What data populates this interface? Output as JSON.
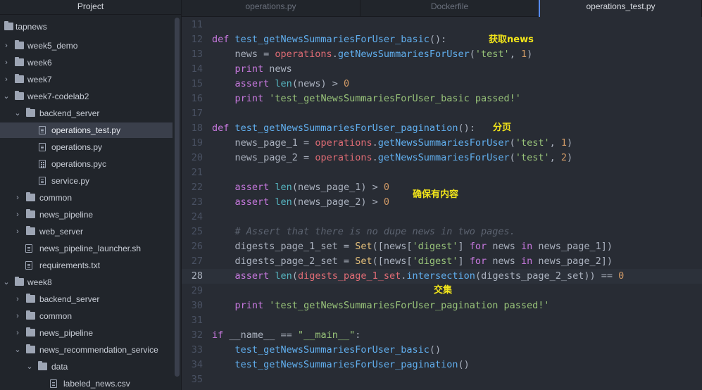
{
  "sidebar": {
    "title": "Project",
    "items": [
      {
        "label": "tapnews",
        "type": "folder",
        "chevron": ""
      },
      {
        "label": "week5_demo",
        "type": "folder",
        "chevron": "›"
      },
      {
        "label": "week6",
        "type": "folder",
        "chevron": "›"
      },
      {
        "label": "week7",
        "type": "folder",
        "chevron": "›"
      },
      {
        "label": "week7-codelab2",
        "type": "folder",
        "chevron": "⌄"
      },
      {
        "label": "backend_server",
        "type": "folder",
        "chevron": "⌄"
      },
      {
        "label": "operations_test.py",
        "type": "file",
        "chevron": ""
      },
      {
        "label": "operations.py",
        "type": "file",
        "chevron": ""
      },
      {
        "label": "operations.pyc",
        "type": "binfile",
        "chevron": ""
      },
      {
        "label": "service.py",
        "type": "file",
        "chevron": ""
      },
      {
        "label": "common",
        "type": "folder",
        "chevron": "›"
      },
      {
        "label": "news_pipeline",
        "type": "folder",
        "chevron": "›"
      },
      {
        "label": "web_server",
        "type": "folder",
        "chevron": "›"
      },
      {
        "label": "news_pipeline_launcher.sh",
        "type": "file",
        "chevron": ""
      },
      {
        "label": "requirements.txt",
        "type": "file",
        "chevron": ""
      },
      {
        "label": "week8",
        "type": "folder",
        "chevron": "⌄"
      },
      {
        "label": "backend_server",
        "type": "folder",
        "chevron": "›"
      },
      {
        "label": "common",
        "type": "folder",
        "chevron": "›"
      },
      {
        "label": "news_pipeline",
        "type": "folder",
        "chevron": "›"
      },
      {
        "label": "news_recommendation_service",
        "type": "folder",
        "chevron": "⌄"
      },
      {
        "label": "data",
        "type": "folder",
        "chevron": "⌄"
      },
      {
        "label": "labeled_news.csv",
        "type": "file",
        "chevron": ""
      }
    ]
  },
  "tabs": [
    {
      "label": "operations.py",
      "active": false
    },
    {
      "label": "Dockerfile",
      "active": false
    },
    {
      "label": "operations_test.py",
      "active": true
    }
  ],
  "editor": {
    "cursor_line": "28",
    "lines": [
      {
        "num": "11",
        "tokens": []
      },
      {
        "num": "12",
        "tokens": [
          [
            "kw",
            "def "
          ],
          [
            "fn",
            "test_getNewsSummariesForUser_basic"
          ],
          [
            "id",
            "():"
          ]
        ]
      },
      {
        "num": "13",
        "tokens": [
          [
            "id",
            "    news = "
          ],
          [
            "mod",
            "operations"
          ],
          [
            "id",
            "."
          ],
          [
            "fn",
            "getNewsSummariesForUser"
          ],
          [
            "id",
            "("
          ],
          [
            "str",
            "'test'"
          ],
          [
            "id",
            ", "
          ],
          [
            "num",
            "1"
          ],
          [
            "id",
            ")"
          ]
        ]
      },
      {
        "num": "14",
        "tokens": [
          [
            "id",
            "    "
          ],
          [
            "kw",
            "print"
          ],
          [
            "id",
            " news"
          ]
        ]
      },
      {
        "num": "15",
        "tokens": [
          [
            "id",
            "    "
          ],
          [
            "kw",
            "assert "
          ],
          [
            "bi",
            "len"
          ],
          [
            "id",
            "(news) > "
          ],
          [
            "num",
            "0"
          ]
        ]
      },
      {
        "num": "16",
        "tokens": [
          [
            "id",
            "    "
          ],
          [
            "kw",
            "print "
          ],
          [
            "str",
            "'test_getNewsSummariesForUser_basic passed!'"
          ]
        ]
      },
      {
        "num": "17",
        "tokens": []
      },
      {
        "num": "18",
        "tokens": [
          [
            "kw",
            "def "
          ],
          [
            "fn",
            "test_getNewsSummariesForUser_pagination"
          ],
          [
            "id",
            "():"
          ]
        ]
      },
      {
        "num": "19",
        "tokens": [
          [
            "id",
            "    news_page_1 = "
          ],
          [
            "mod",
            "operations"
          ],
          [
            "id",
            "."
          ],
          [
            "fn",
            "getNewsSummariesForUser"
          ],
          [
            "id",
            "("
          ],
          [
            "str",
            "'test'"
          ],
          [
            "id",
            ", "
          ],
          [
            "num",
            "1"
          ],
          [
            "id",
            ")"
          ]
        ]
      },
      {
        "num": "20",
        "tokens": [
          [
            "id",
            "    news_page_2 = "
          ],
          [
            "mod",
            "operations"
          ],
          [
            "id",
            "."
          ],
          [
            "fn",
            "getNewsSummariesForUser"
          ],
          [
            "id",
            "("
          ],
          [
            "str",
            "'test'"
          ],
          [
            "id",
            ", "
          ],
          [
            "num",
            "2"
          ],
          [
            "id",
            ")"
          ]
        ]
      },
      {
        "num": "21",
        "tokens": []
      },
      {
        "num": "22",
        "tokens": [
          [
            "id",
            "    "
          ],
          [
            "kw",
            "assert "
          ],
          [
            "bi",
            "len"
          ],
          [
            "id",
            "(news_page_1) > "
          ],
          [
            "num",
            "0"
          ]
        ]
      },
      {
        "num": "23",
        "tokens": [
          [
            "id",
            "    "
          ],
          [
            "kw",
            "assert "
          ],
          [
            "bi",
            "len"
          ],
          [
            "id",
            "(news_page_2) > "
          ],
          [
            "num",
            "0"
          ]
        ]
      },
      {
        "num": "24",
        "tokens": []
      },
      {
        "num": "25",
        "tokens": [
          [
            "cmt",
            "    # Assert that there is no dupe news in two pages."
          ]
        ]
      },
      {
        "num": "26",
        "tokens": [
          [
            "id",
            "    digests_page_1_set = "
          ],
          [
            "cls",
            "Set"
          ],
          [
            "id",
            "([news["
          ],
          [
            "str",
            "'digest'"
          ],
          [
            "id",
            "] "
          ],
          [
            "kw",
            "for"
          ],
          [
            "id",
            " news "
          ],
          [
            "kw",
            "in"
          ],
          [
            "id",
            " news_page_1])"
          ]
        ]
      },
      {
        "num": "27",
        "tokens": [
          [
            "id",
            "    digests_page_2_set = "
          ],
          [
            "cls",
            "Set"
          ],
          [
            "id",
            "([news["
          ],
          [
            "str",
            "'digest'"
          ],
          [
            "id",
            "] "
          ],
          [
            "kw",
            "for"
          ],
          [
            "id",
            " news "
          ],
          [
            "kw",
            "in"
          ],
          [
            "id",
            " news_page_2])"
          ]
        ]
      },
      {
        "num": "28",
        "tokens": [
          [
            "id",
            "    "
          ],
          [
            "kw",
            "assert "
          ],
          [
            "bi",
            "len"
          ],
          [
            "id",
            "("
          ],
          [
            "mod",
            "digests_page_1_set"
          ],
          [
            "id",
            "."
          ],
          [
            "fn",
            "intersection"
          ],
          [
            "id",
            "(digests_page_2_set)) == "
          ],
          [
            "num",
            "0"
          ]
        ]
      },
      {
        "num": "29",
        "tokens": []
      },
      {
        "num": "30",
        "tokens": [
          [
            "id",
            "    "
          ],
          [
            "kw",
            "print "
          ],
          [
            "str",
            "'test_getNewsSummariesForUser_pagination passed!'"
          ]
        ]
      },
      {
        "num": "31",
        "tokens": []
      },
      {
        "num": "32",
        "tokens": [
          [
            "kw",
            "if "
          ],
          [
            "id",
            "__name__ == "
          ],
          [
            "str",
            "\"__main__\""
          ],
          [
            "id",
            ":"
          ]
        ]
      },
      {
        "num": "33",
        "tokens": [
          [
            "id",
            "    "
          ],
          [
            "fn",
            "test_getNewsSummariesForUser_basic"
          ],
          [
            "id",
            "()"
          ]
        ]
      },
      {
        "num": "34",
        "tokens": [
          [
            "id",
            "    "
          ],
          [
            "fn",
            "test_getNewsSummariesForUser_pagination"
          ],
          [
            "id",
            "()"
          ]
        ]
      },
      {
        "num": "35",
        "tokens": []
      }
    ],
    "annotations": {
      "fetch": "获取news",
      "pagination": "分页",
      "ensure": "确保有内容",
      "intersection": "交集"
    }
  },
  "colors": {
    "sidebar_bg": "#21252b",
    "editor_bg": "#282c34",
    "keyword": "#c678dd",
    "function": "#61afef",
    "string": "#98c379",
    "number": "#d19a66",
    "annotation": "#f2e51a",
    "active_tab_accent": "#568af2"
  }
}
